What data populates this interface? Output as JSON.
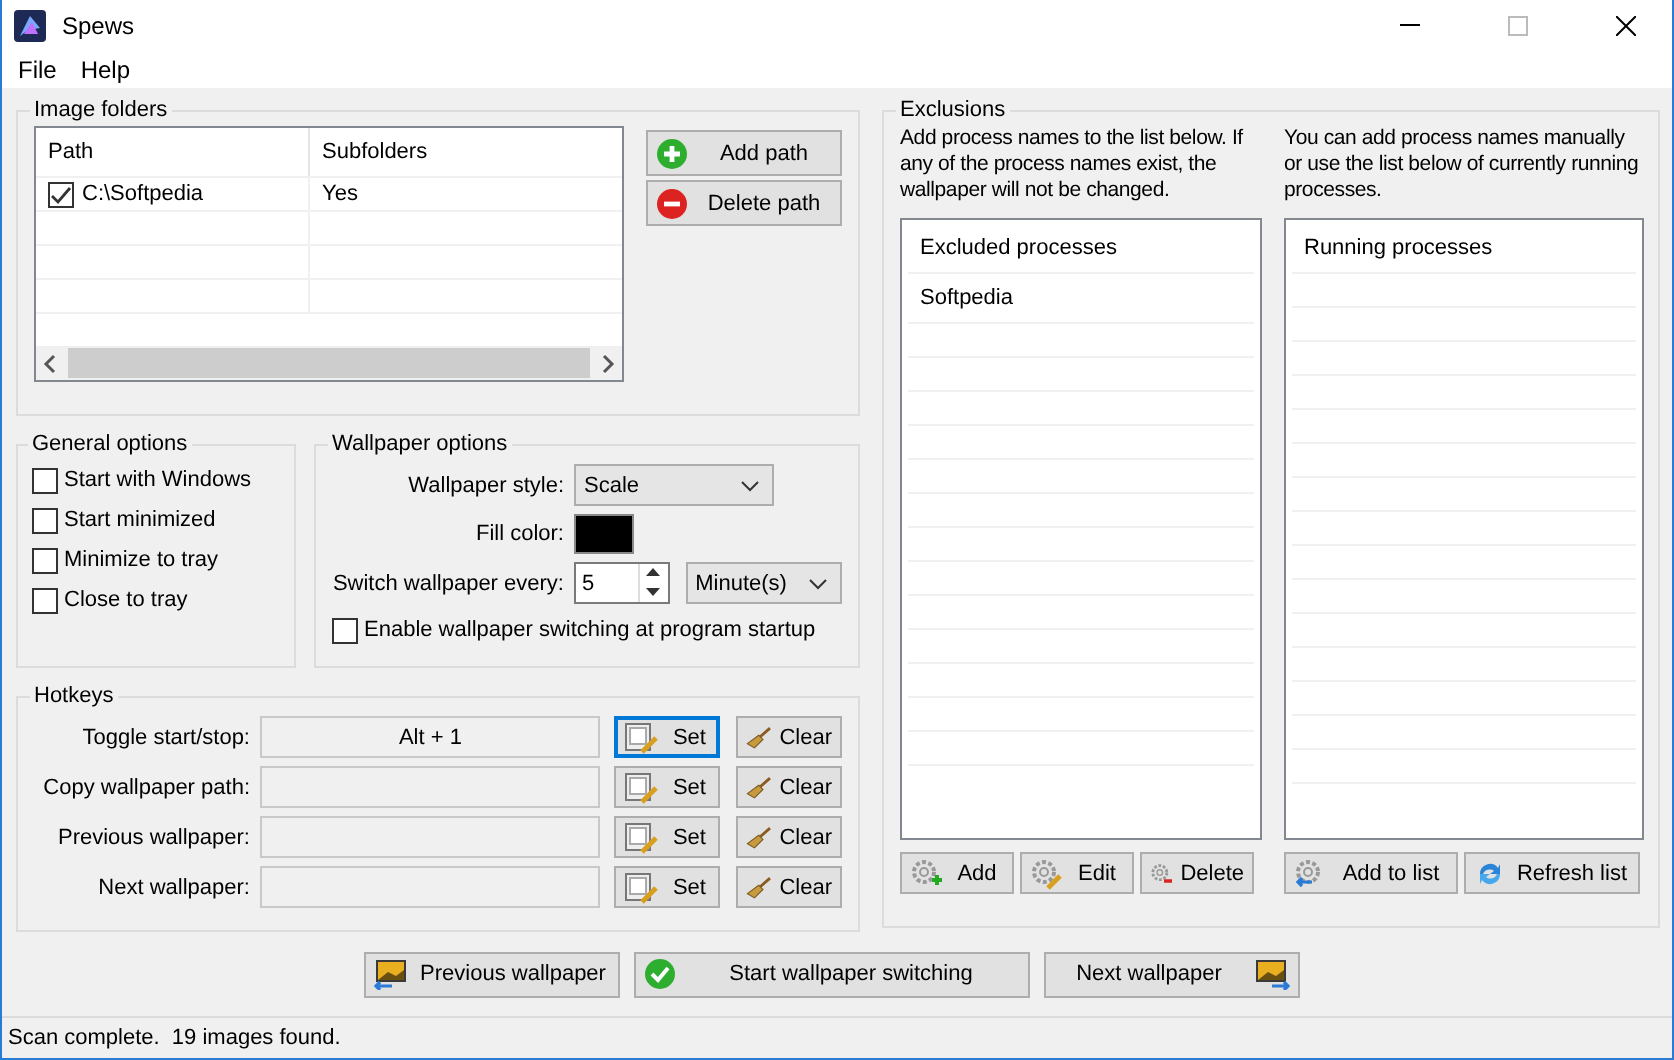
{
  "window": {
    "title": "Spews"
  },
  "menu": [
    "File",
    "Help"
  ],
  "image_folders": {
    "title": "Image folders",
    "columns": [
      "Path",
      "Subfolders"
    ],
    "rows": [
      {
        "path": "C:\\Softpedia",
        "subfolders": "Yes",
        "checked": true
      }
    ],
    "buttons": [
      {
        "label": "Add path",
        "kind": "add"
      },
      {
        "label": "Delete path",
        "kind": "delete"
      }
    ]
  },
  "general_options": {
    "title": "General options",
    "options": [
      {
        "label": "Start with Windows",
        "checked": false
      },
      {
        "label": "Start minimized",
        "checked": false
      },
      {
        "label": "Minimize to tray",
        "checked": false
      },
      {
        "label": "Close to tray",
        "checked": false
      }
    ]
  },
  "wallpaper_options": {
    "title": "Wallpaper options",
    "style_label": "Wallpaper style:",
    "style": "Scale",
    "fill_label": "Fill color:",
    "interval_label": "Switch wallpaper every:",
    "interval": "5",
    "unit": "Minute(s)",
    "startup": {
      "label": "Enable wallpaper switching at program startup",
      "checked": false
    }
  },
  "hotkeys": {
    "title": "Hotkeys",
    "rows": [
      {
        "label": "Toggle start/stop:",
        "value": "Alt + 1",
        "set": "Set",
        "clear": "Clear",
        "focused": true
      },
      {
        "label": "Copy wallpaper path:",
        "set": "Set",
        "clear": "Clear",
        "focused": false
      },
      {
        "label": "Previous wallpaper:",
        "set": "Set",
        "clear": "Clear",
        "focused": false
      },
      {
        "label": "Next wallpaper:",
        "set": "Set",
        "clear": "Clear",
        "focused": false
      }
    ]
  },
  "exclusions": {
    "title": "Exclusions",
    "left_note": "Add process names to the list below. If any of the process names exist, the wallpaper will not be changed.",
    "right_note": "You can add process names manually or use the list below of currently running processes.",
    "excluded": {
      "header": "Excluded processes",
      "items": [
        "Softpedia"
      ]
    },
    "running": {
      "header": "Running processes"
    },
    "left_buttons": [
      {
        "label": "Add",
        "kind": "add"
      },
      {
        "label": "Edit",
        "kind": "edit"
      },
      {
        "label": "Delete",
        "kind": "delete"
      }
    ],
    "right_buttons": [
      {
        "label": "Add to list",
        "kind": "add_to_list"
      },
      {
        "label": "Refresh list",
        "kind": "refresh"
      }
    ]
  },
  "bottom_buttons": [
    {
      "label": "Previous wallpaper",
      "kind": "previous"
    },
    {
      "label": "Start wallpaper switching",
      "kind": "start"
    },
    {
      "label": "Next wallpaper",
      "kind": "next"
    }
  ],
  "status_bar": "Scan complete.  19 images found."
}
